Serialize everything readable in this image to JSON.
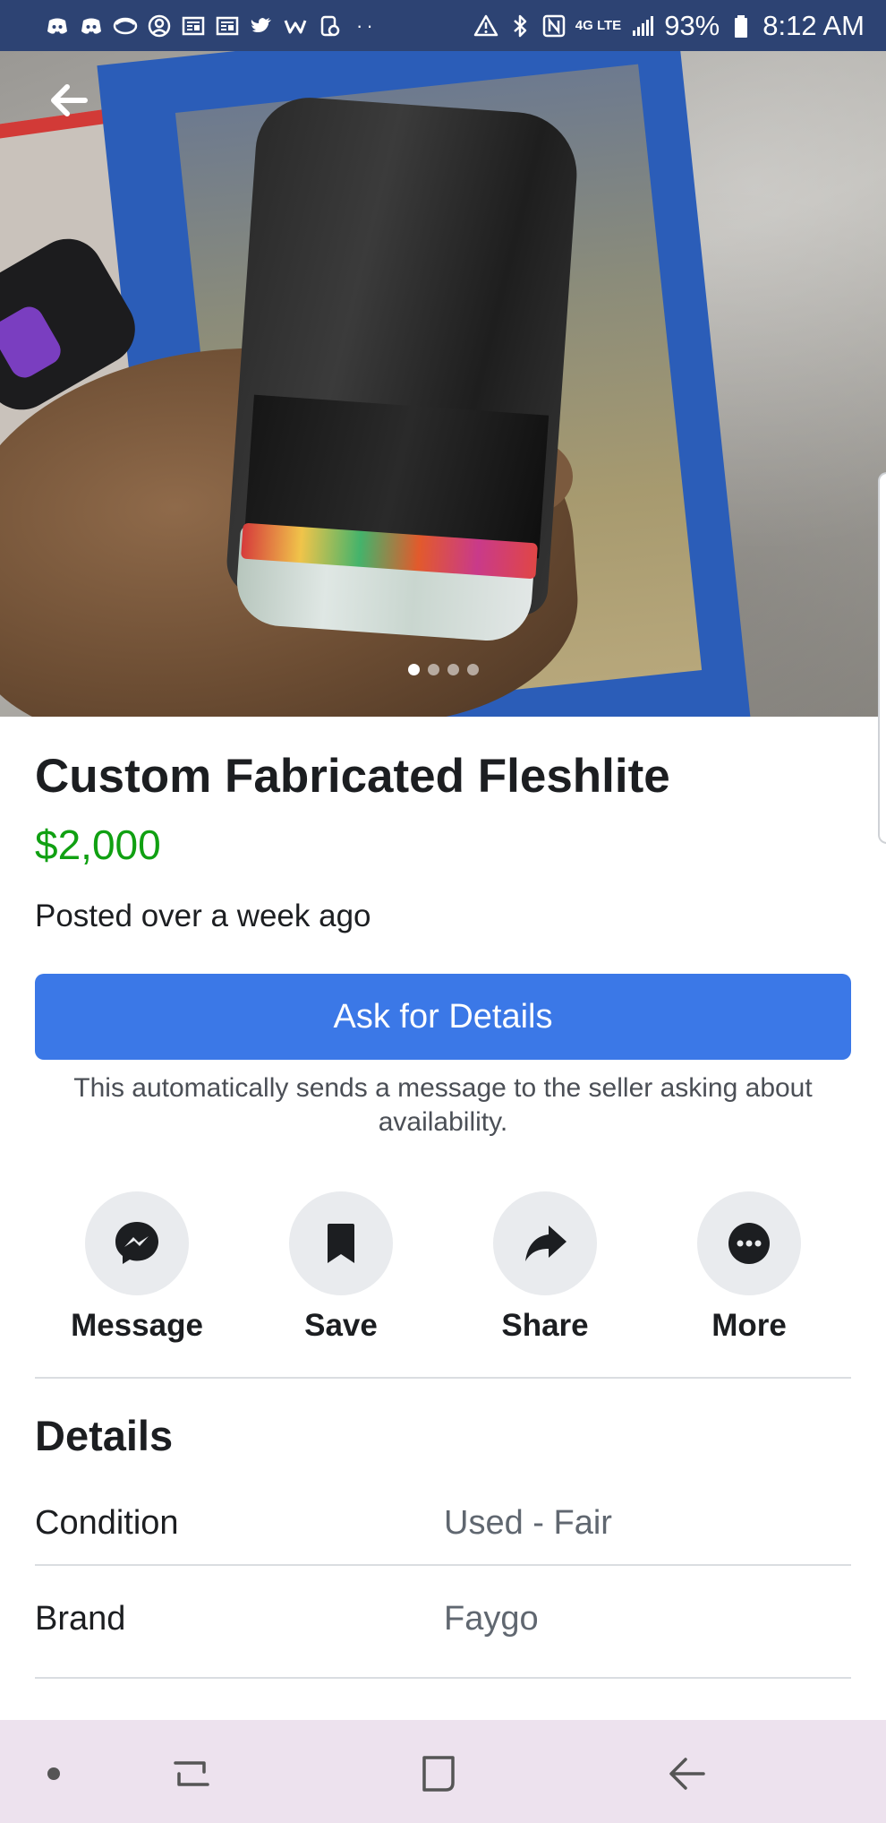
{
  "status_bar": {
    "battery": "93%",
    "time": "8:12 AM",
    "network": "4G LTE",
    "left_icons": [
      "discord-icon",
      "discord-icon",
      "sync-icon",
      "account-icon",
      "news-icon",
      "news-icon",
      "twitter-icon",
      "w-app-icon",
      "clipboard-icon"
    ],
    "right_icons": [
      "alert-icon",
      "bluetooth-icon",
      "nfc-icon",
      "signal-icon",
      "battery-icon"
    ]
  },
  "photo": {
    "page_count": 4,
    "current_page": 1
  },
  "listing": {
    "title": "Custom Fabricated Fleshlite",
    "price": "$2,000",
    "posted": "Posted over a week ago"
  },
  "ask_button": {
    "label": "Ask for Details",
    "note": "This automatically sends a message to the seller asking about availability."
  },
  "actions": [
    {
      "label": "Message",
      "icon": "messenger-icon"
    },
    {
      "label": "Save",
      "icon": "bookmark-icon"
    },
    {
      "label": "Share",
      "icon": "share-arrow-icon"
    },
    {
      "label": "More",
      "icon": "more-dots-icon"
    }
  ],
  "details": {
    "heading": "Details",
    "rows": [
      {
        "key": "Condition",
        "value": "Used - Fair"
      },
      {
        "key": "Brand",
        "value": "Faygo"
      }
    ]
  },
  "colors": {
    "status_bar_bg": "#2d4373",
    "accent": "#3b78e7",
    "price": "#10a012",
    "nav_bar_bg": "#ede2ee"
  }
}
